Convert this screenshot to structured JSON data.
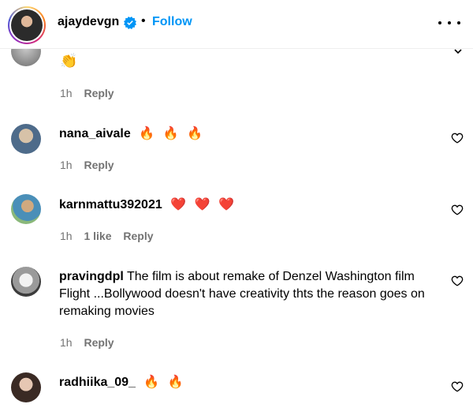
{
  "header": {
    "username": "ajaydevgn",
    "separator": "•",
    "follow_label": "Follow"
  },
  "comments": [
    {
      "username": "",
      "text": "",
      "emoji": "clapping-hands",
      "time": "1h",
      "likes": "",
      "reply": "Reply"
    },
    {
      "username": "nana_aivale",
      "text": "",
      "emoji": "fire x3",
      "time": "1h",
      "likes": "",
      "reply": "Reply"
    },
    {
      "username": "karnmattu392021",
      "text": "",
      "emoji": "red-heart x3",
      "time": "1h",
      "likes": "1 like",
      "reply": "Reply"
    },
    {
      "username": "pravingdpl",
      "text": "The film is about remake of Denzel Washington film Flight ...Bollywood doesn't have creativity thts the reason goes on remaking movies",
      "time": "1h",
      "likes": "",
      "reply": "Reply"
    },
    {
      "username": "radhiika_09_",
      "text": "",
      "emoji": "fire x2",
      "time": "",
      "likes": "",
      "reply": ""
    }
  ],
  "colors": {
    "link": "#0095f6",
    "meta": "#737373",
    "border": "#efefef"
  },
  "icons": [
    "verified-badge-icon",
    "more-options-icon",
    "heart-icon",
    "fire-emoji",
    "red-heart-emoji",
    "clapping-hands-emoji"
  ]
}
